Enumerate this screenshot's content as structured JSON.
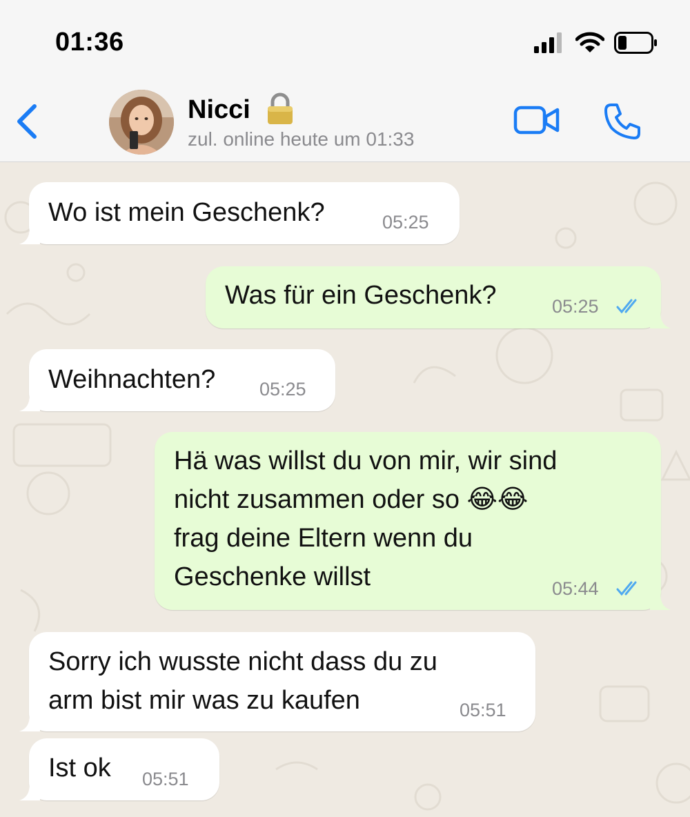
{
  "status_bar": {
    "time": "01:36"
  },
  "header": {
    "contact_name": "Nicci",
    "last_seen": "zul. online heute um 01:33"
  },
  "colors": {
    "accent": "#1a7cf5",
    "incoming_bubble": "#ffffff",
    "outgoing_bubble": "#e7fcd6",
    "read_ticks": "#4fa9f0",
    "chat_background": "#efeae2"
  },
  "messages": [
    {
      "direction": "incoming",
      "text": "Wo ist mein Geschenk?",
      "time": "05:25"
    },
    {
      "direction": "outgoing",
      "text": "Was für ein Geschenk?",
      "time": "05:25",
      "status": "read"
    },
    {
      "direction": "incoming",
      "text": "Weihnachten?",
      "time": "05:25"
    },
    {
      "direction": "outgoing",
      "text": "Hä was willst du von mir, wir sind\nnicht zusammen oder so 😂😂\nfrag deine Eltern wenn du\nGeschenke willst",
      "time": "05:44",
      "status": "read"
    },
    {
      "direction": "incoming",
      "text": "Sorry ich wusste nicht dass du zu\narm bist mir was zu kaufen",
      "time": "05:51"
    },
    {
      "direction": "incoming",
      "text": "Ist ok",
      "time": "05:51"
    }
  ]
}
